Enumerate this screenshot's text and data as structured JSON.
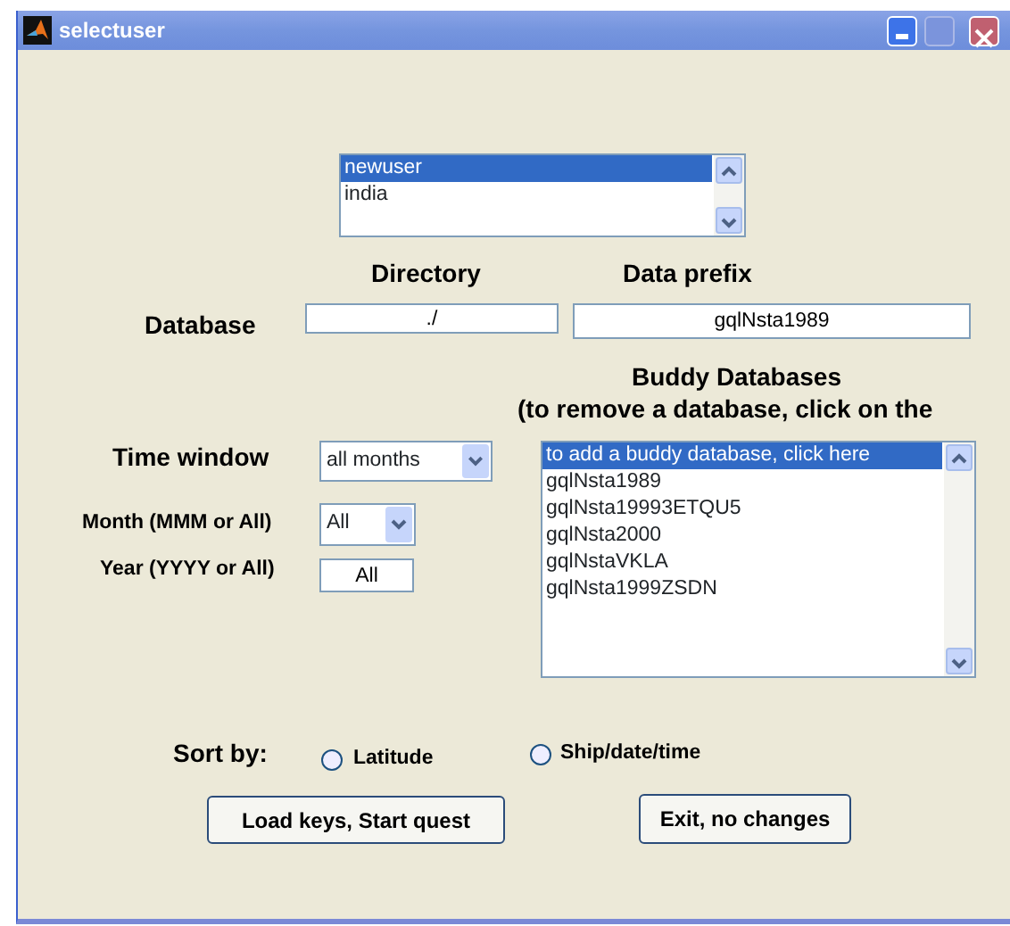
{
  "window": {
    "title": "selectuser"
  },
  "user_list": {
    "items": [
      {
        "label": "newuser",
        "selected": true
      },
      {
        "label": "india",
        "selected": false
      }
    ]
  },
  "labels": {
    "directory": "Directory",
    "data_prefix": "Data prefix",
    "database": "Database",
    "buddy_title": "Buddy Databases",
    "buddy_hint": "(to remove a database, click on the",
    "time_window": "Time window",
    "month": "Month (MMM or All)",
    "year": "Year (YYYY or All)",
    "sort_by": "Sort by:"
  },
  "directory": {
    "value": "./"
  },
  "data_prefix": {
    "value": "gqlNsta1989"
  },
  "time_window": {
    "value": "all months"
  },
  "month": {
    "value": "All"
  },
  "year": {
    "value": "All"
  },
  "buddy_list": {
    "items": [
      {
        "label": "to add a buddy database, click here",
        "selected": true
      },
      {
        "label": "gqlNsta1989",
        "selected": false
      },
      {
        "label": "gqlNsta19993ETQU5",
        "selected": false
      },
      {
        "label": "gqlNsta2000",
        "selected": false
      },
      {
        "label": "gqlNstaVKLA",
        "selected": false
      },
      {
        "label": "gqlNsta1999ZSDN",
        "selected": false
      }
    ]
  },
  "sort_options": [
    {
      "label": "Latitude",
      "selected": false
    },
    {
      "label": "Ship/date/time",
      "selected": false
    }
  ],
  "buttons": [
    {
      "label": "Load keys, Start quest"
    },
    {
      "label": "Exit, no changes"
    }
  ]
}
